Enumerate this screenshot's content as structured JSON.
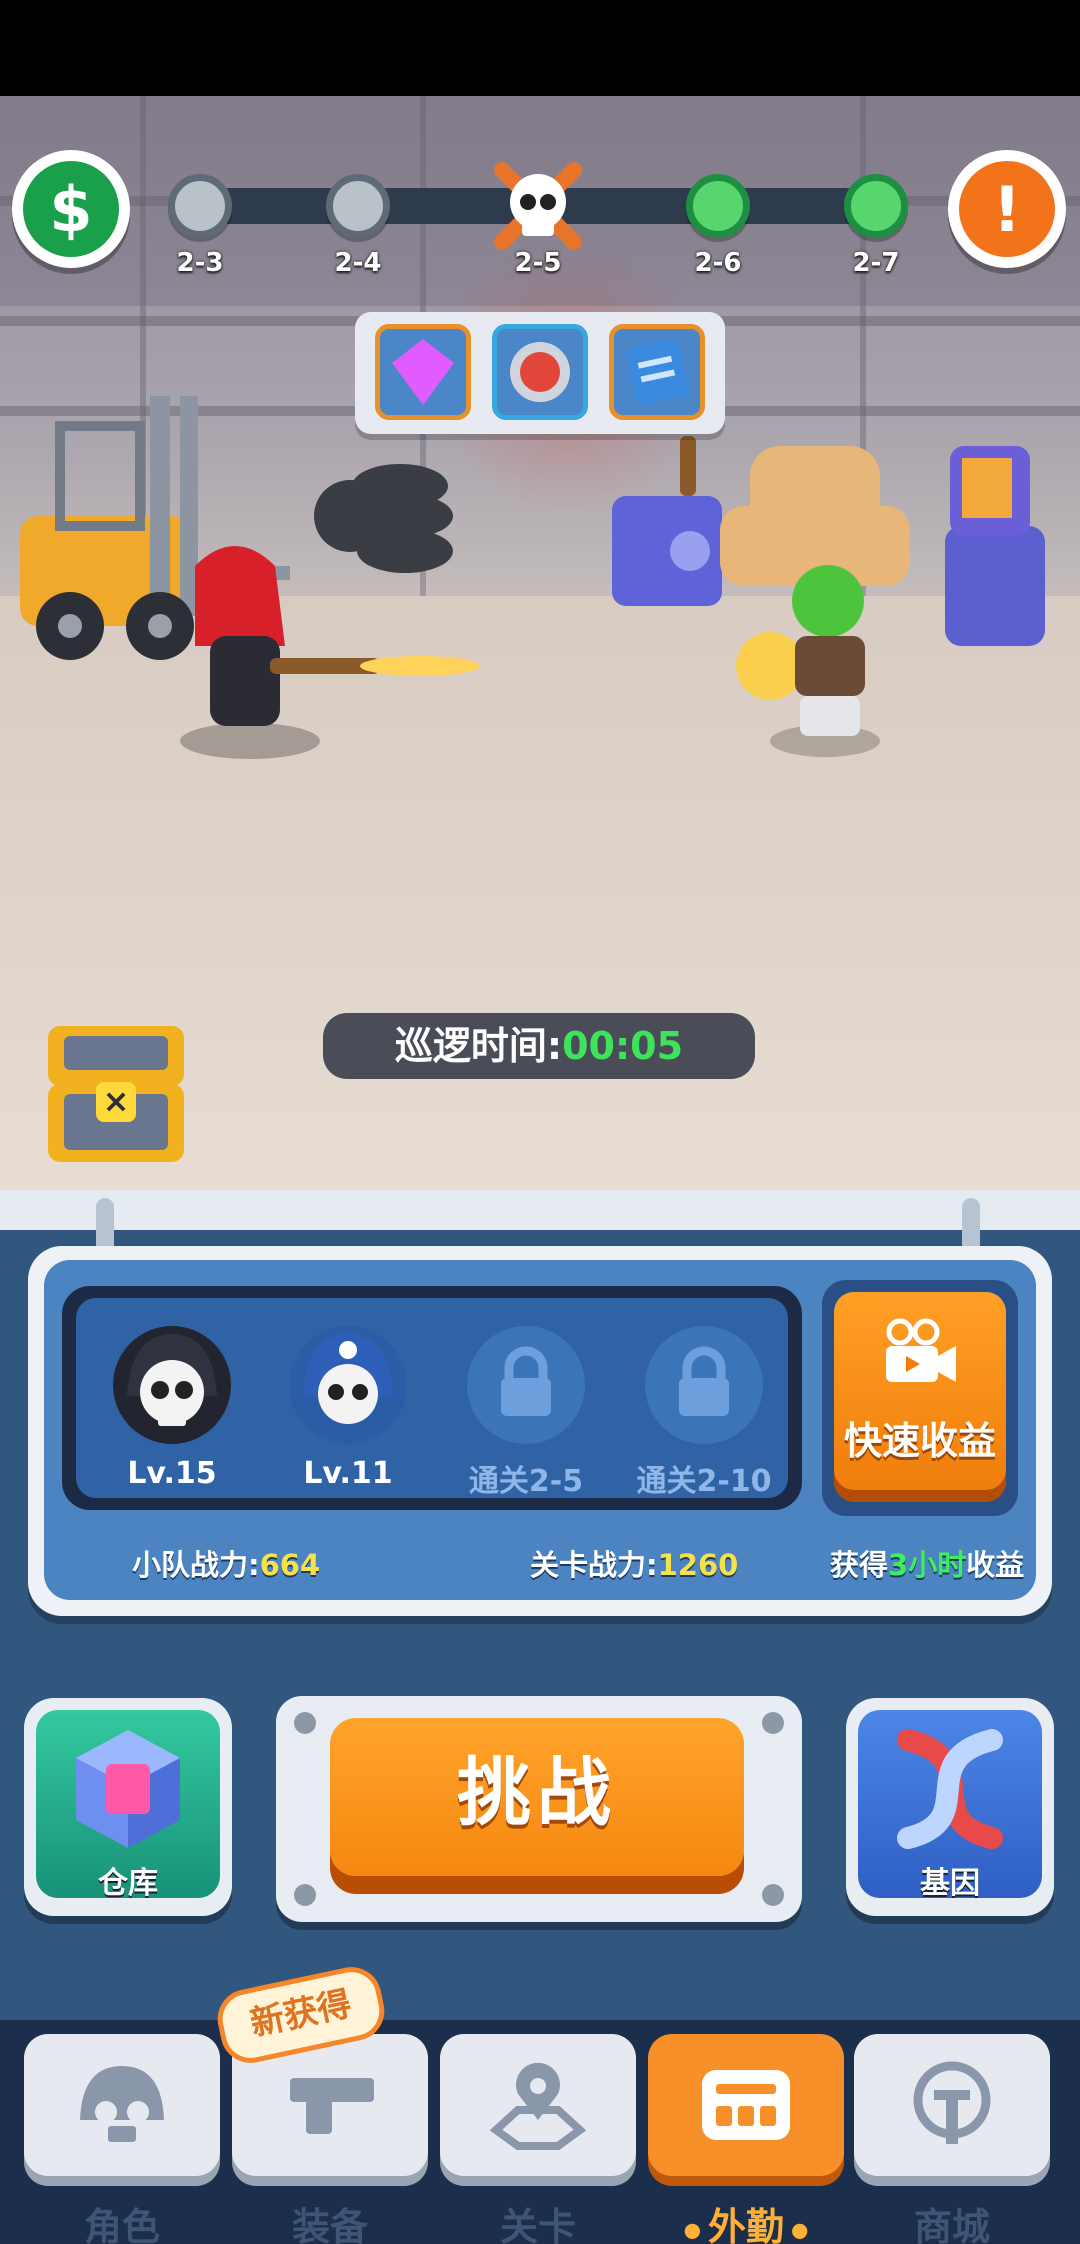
{
  "stages": {
    "nodes": [
      {
        "label": "2-3",
        "state": "locked"
      },
      {
        "label": "2-4",
        "state": "locked"
      },
      {
        "label": "2-5",
        "state": "current-boss"
      },
      {
        "label": "2-6",
        "state": "cleared"
      },
      {
        "label": "2-7",
        "state": "cleared"
      }
    ]
  },
  "top_buttons": {
    "left_icon": "cash-plus-icon",
    "right_icon": "alert-icon"
  },
  "rewards": [
    {
      "icon": "gem-icon",
      "color": "#e05cff"
    },
    {
      "icon": "fist-emblem-icon",
      "color": "#e0463a"
    },
    {
      "icon": "blueprint-icon",
      "color": "#3a8ae0"
    }
  ],
  "patrol": {
    "label": "巡逻时间:",
    "time": "00:05"
  },
  "squad": {
    "slots": [
      {
        "label": "Lv.15",
        "state": "unlocked",
        "icon": "skull-hero-icon"
      },
      {
        "label": "Lv.11",
        "state": "unlocked",
        "icon": "blue-hero-icon"
      },
      {
        "label": "通关2-5",
        "state": "locked",
        "icon": "lock-icon"
      },
      {
        "label": "通关2-10",
        "state": "locked",
        "icon": "lock-icon"
      }
    ],
    "power_label": "小队战力:",
    "power_value": "664",
    "stage_power_label": "关卡战力:",
    "stage_power_value": "1260"
  },
  "fast_income": {
    "label": "快速收益",
    "icon": "video-camera-icon",
    "gain_prefix": "获得",
    "gain_hours": "3小时",
    "gain_suffix": "收益"
  },
  "actions": {
    "warehouse": "仓库",
    "challenge": "挑战",
    "gene": "基因"
  },
  "nav": {
    "new_badge": "新获得",
    "tabs": [
      {
        "label": "角色",
        "icon": "skull-icon",
        "active": false
      },
      {
        "label": "装备",
        "icon": "gun-icon",
        "active": false
      },
      {
        "label": "关卡",
        "icon": "map-pin-icon",
        "active": false
      },
      {
        "label": "外勤",
        "icon": "field-icon",
        "active": true
      },
      {
        "label": "商城",
        "icon": "shop-icon",
        "active": false
      }
    ]
  },
  "colors": {
    "accent_orange": "#f6870f",
    "green": "#3de35a",
    "panel_blue": "#32577f"
  }
}
